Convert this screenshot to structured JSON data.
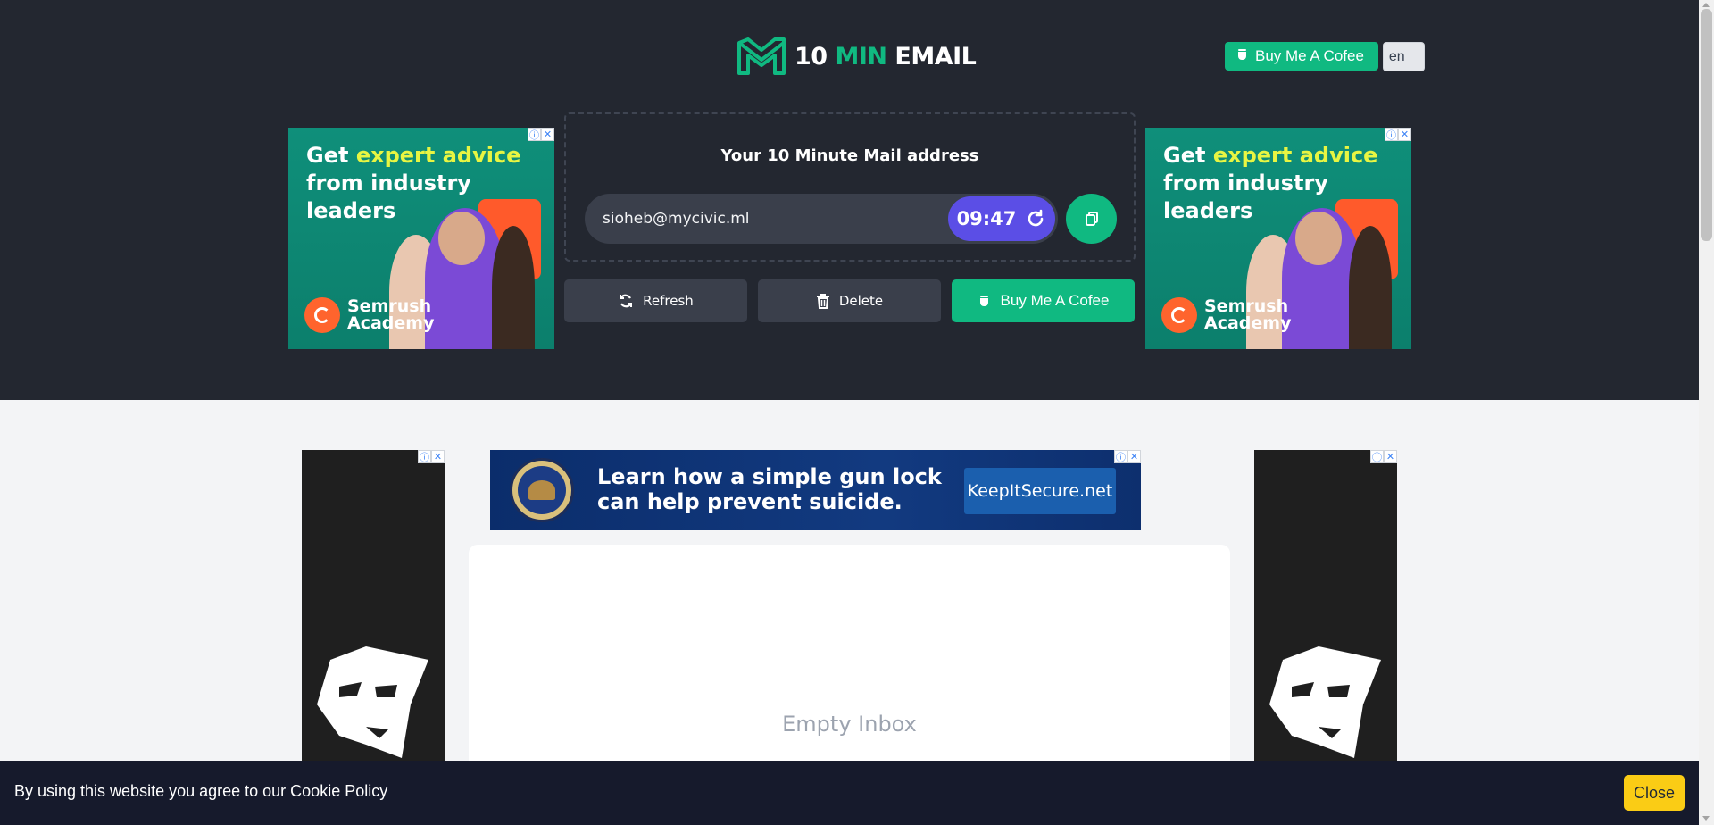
{
  "header": {
    "logo_prefix": "10 ",
    "logo_accent": "MIN",
    "logo_suffix": " EMAIL",
    "coffee_label": "Buy Me A Cofee",
    "language": "en"
  },
  "ad_square": {
    "headline_start": "Get ",
    "headline_accent": "expert advice",
    "headline_rest": "from industry leaders",
    "brand_line1": "Semrush",
    "brand_line2": "Academy"
  },
  "mail": {
    "title": "Your 10 Minute Mail address",
    "address": "sioheb@mycivic.ml",
    "timer": "09:47"
  },
  "actions": {
    "refresh_label": "Refresh",
    "delete_label": "Delete",
    "coffee_label": "Buy Me A Cofee"
  },
  "banner_ad": {
    "line1": "Learn how a simple gun lock",
    "line2": "can help prevent suicide.",
    "cta": "KeepItSecure.net"
  },
  "inbox": {
    "empty_text": "Empty Inbox"
  },
  "cookie": {
    "text": "By using this website you agree to our Cookie Policy",
    "close_label": "Close"
  },
  "colors": {
    "hero_bg": "#232730",
    "accent_green": "#10b981",
    "timer_purple": "#5b4ee6",
    "cookie_bg": "#161a2c",
    "close_yellow": "#facc15"
  },
  "icons": [
    "mail-logo-icon",
    "coffee-cup-icon",
    "refresh-icon",
    "trash-icon",
    "copy-icon",
    "adchoices-icon",
    "close-icon"
  ]
}
